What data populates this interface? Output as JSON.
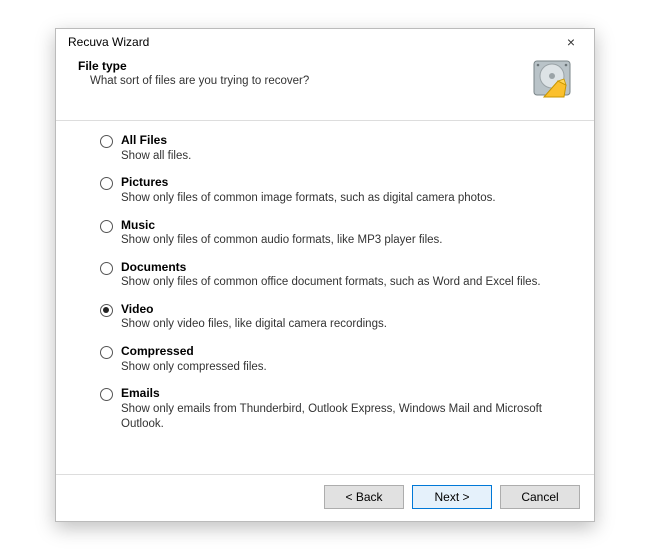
{
  "window": {
    "title": "Recuva Wizard",
    "close_label": "×"
  },
  "header": {
    "heading": "File type",
    "subheading": "What sort of files are you trying to recover?",
    "icon": "hard-drive-recovery-icon"
  },
  "options": [
    {
      "id": "all",
      "label": "All Files",
      "desc": "Show all files.",
      "selected": false
    },
    {
      "id": "pictures",
      "label": "Pictures",
      "desc": "Show only files of common image formats, such as digital camera photos.",
      "selected": false
    },
    {
      "id": "music",
      "label": "Music",
      "desc": "Show only files of common audio formats, like MP3 player files.",
      "selected": false
    },
    {
      "id": "documents",
      "label": "Documents",
      "desc": "Show only files of common office document formats, such as Word and Excel files.",
      "selected": false
    },
    {
      "id": "video",
      "label": "Video",
      "desc": "Show only video files, like digital camera recordings.",
      "selected": true
    },
    {
      "id": "compressed",
      "label": "Compressed",
      "desc": "Show only compressed files.",
      "selected": false
    },
    {
      "id": "emails",
      "label": "Emails",
      "desc": "Show only emails from Thunderbird, Outlook Express, Windows Mail and Microsoft Outlook.",
      "selected": false
    }
  ],
  "buttons": {
    "back": "< Back",
    "next": "Next >",
    "cancel": "Cancel"
  }
}
